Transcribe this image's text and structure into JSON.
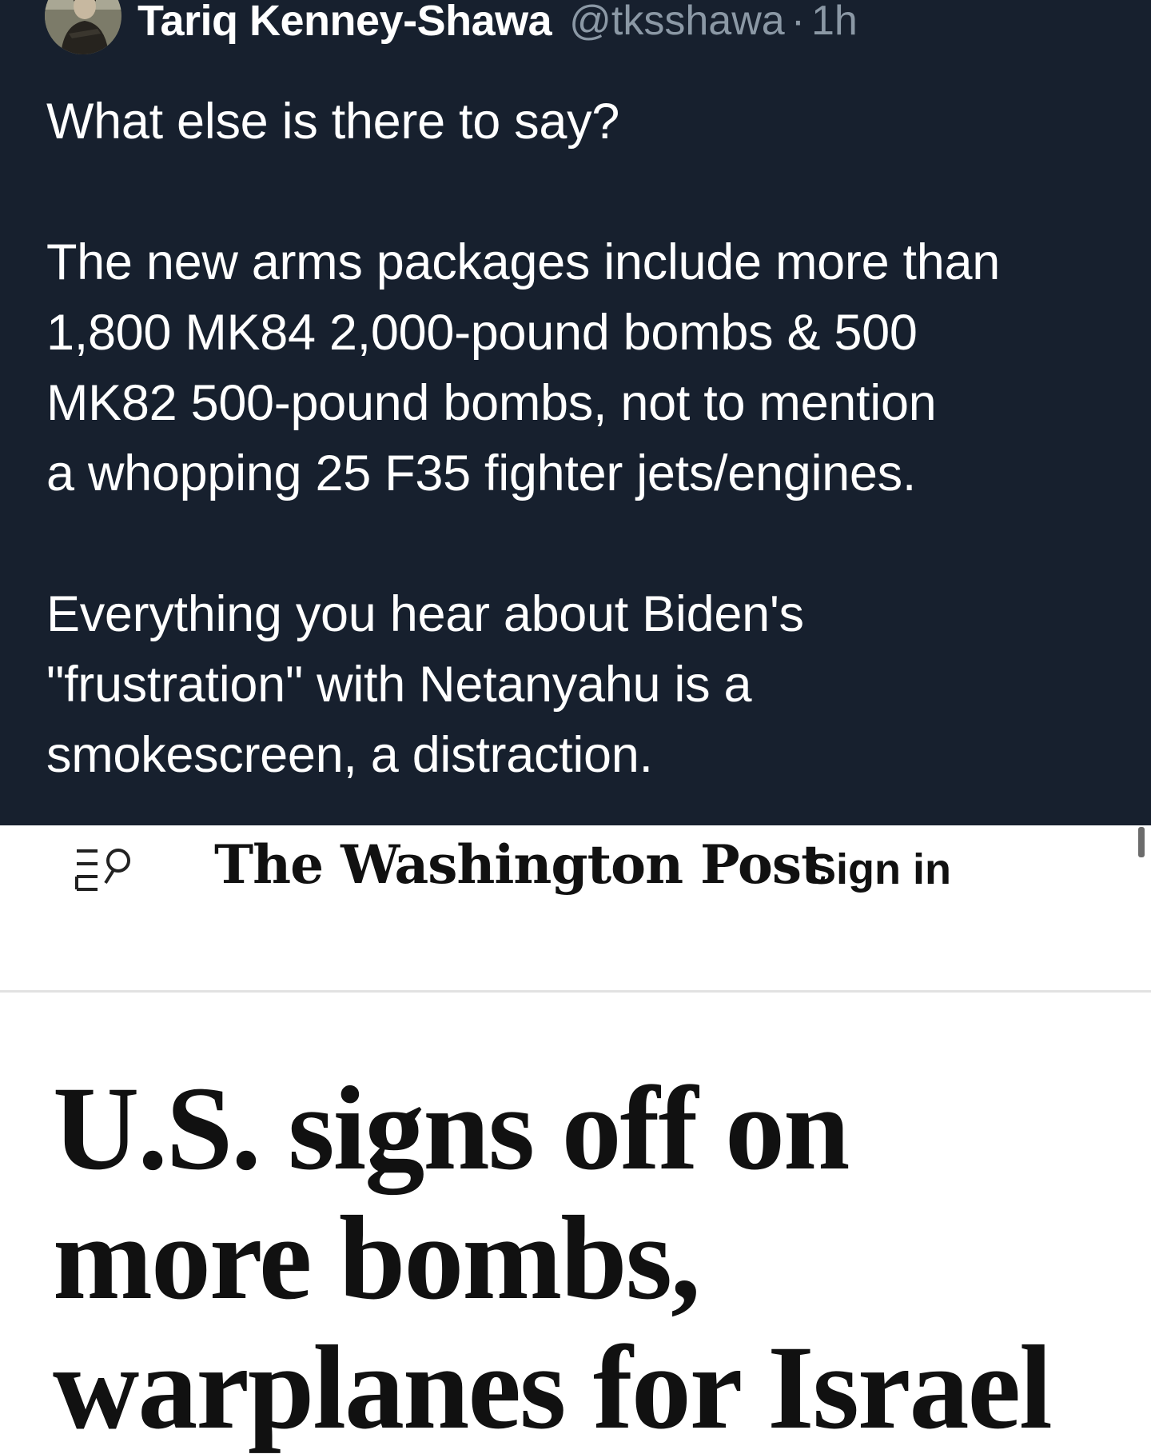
{
  "tweet": {
    "author_name": "Tariq Kenney-Shawa",
    "author_handle": "@tksshawa",
    "separator": "·",
    "timestamp": "1h",
    "paragraphs": [
      "What else is there to say?",
      "The new arms packages include more than\n1,800 MK84 2,000-pound bombs & 500\nMK82 500-pound bombs, not to mention\na whopping 25 F35 fighter jets/engines.",
      "Everything you hear about Biden's\n\"frustration\" with Netanyahu is a\nsmokescreen, a distraction."
    ],
    "colors": {
      "background": "#17202e",
      "text": "#ffffff",
      "secondary": "#8b98a5"
    }
  },
  "article": {
    "publication_logo": "The Washington Post",
    "sign_in_label": "Sign in",
    "headline": "U.S. signs off on\nmore bombs,\nwarplanes for Israel"
  },
  "icons": {
    "menu_search": "menu-search-icon",
    "avatar": "avatar"
  }
}
